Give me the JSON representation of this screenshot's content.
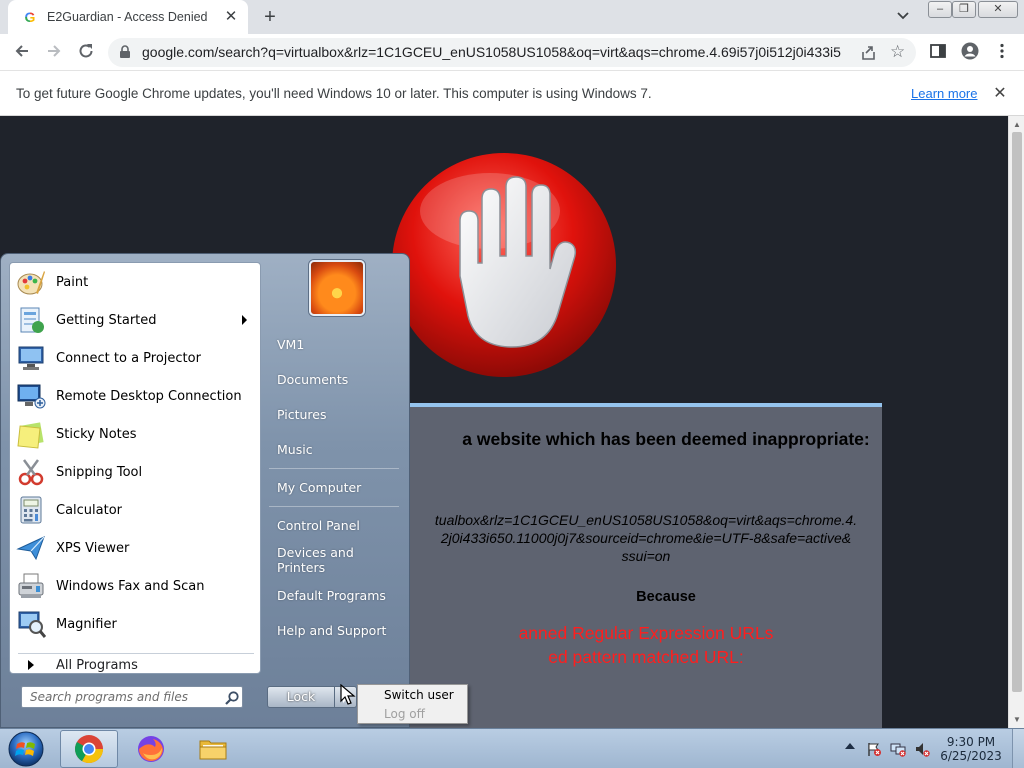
{
  "browser": {
    "tab_title": "E2Guardian - Access Denied",
    "tab_close": "✕",
    "new_tab": "+",
    "url": "google.com/search?q=virtualbox&rlz=1C1GCEU_enUS1058US1058&oq=virt&aqs=chrome.4.69i57j0i512j0i433i5...",
    "window_buttons": {
      "minimize": "–",
      "maximize": "❐",
      "close": "✕"
    }
  },
  "infobar": {
    "message": "To get future Google Chrome updates, you'll need Windows 10 or later. This computer is using Windows 7.",
    "link": "Learn more",
    "close": "✕"
  },
  "page": {
    "heading": "a website which has been deemed inappropriate:",
    "url_lines": [
      "tualbox&rlz=1C1GCEU_enUS1058US1058&oq=virt&aqs=chrome.4.",
      "2j0i433i650.11000j0j7&sourceid=chrome&ie=UTF-8&safe=active&",
      "ssui=on"
    ],
    "because": "Because",
    "reason_lines": [
      "anned Regular Expression URLs",
      "ed pattern matched URL:"
    ],
    "accent_color": "#ff1e1e"
  },
  "start_menu": {
    "programs": [
      {
        "label": "Paint",
        "icon": "paint-icon"
      },
      {
        "label": "Getting Started",
        "icon": "getting-started-icon",
        "submenu": true
      },
      {
        "label": "Connect to a Projector",
        "icon": "projector-icon"
      },
      {
        "label": "Remote Desktop Connection",
        "icon": "remote-desktop-icon"
      },
      {
        "label": "Sticky Notes",
        "icon": "sticky-notes-icon"
      },
      {
        "label": "Snipping Tool",
        "icon": "snipping-tool-icon"
      },
      {
        "label": "Calculator",
        "icon": "calculator-icon"
      },
      {
        "label": "XPS Viewer",
        "icon": "xps-viewer-icon"
      },
      {
        "label": "Windows Fax and Scan",
        "icon": "fax-scan-icon"
      },
      {
        "label": "Magnifier",
        "icon": "magnifier-icon"
      }
    ],
    "all_programs": "All Programs",
    "search_placeholder": "Search programs and files",
    "right_items": [
      "VM1",
      "Documents",
      "Pictures",
      "Music",
      "My Computer",
      "Control Panel",
      "Devices and Printers",
      "Default Programs",
      "Help and Support"
    ],
    "lock_button": "Lock",
    "power_menu": {
      "switch_user": "Switch user",
      "log_off": "Log off"
    }
  },
  "taskbar": {
    "pinned": [
      "chrome-icon",
      "firefox-icon",
      "file-explorer-icon"
    ],
    "clock_time": "9:30 PM",
    "clock_date": "6/25/2023"
  }
}
